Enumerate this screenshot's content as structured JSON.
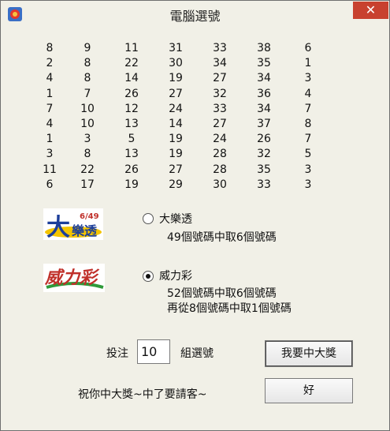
{
  "window": {
    "title": "電腦選號",
    "close_label": "✕"
  },
  "numbers": [
    [
      "8",
      "9",
      "11",
      "31",
      "33",
      "38",
      "6"
    ],
    [
      "2",
      "8",
      "22",
      "30",
      "34",
      "35",
      "1"
    ],
    [
      "4",
      "8",
      "14",
      "19",
      "27",
      "34",
      "3"
    ],
    [
      "1",
      "7",
      "26",
      "27",
      "32",
      "36",
      "4"
    ],
    [
      "7",
      "10",
      "12",
      "24",
      "33",
      "34",
      "7"
    ],
    [
      "4",
      "10",
      "13",
      "14",
      "27",
      "37",
      "8"
    ],
    [
      "1",
      "3",
      "5",
      "19",
      "24",
      "26",
      "7"
    ],
    [
      "3",
      "8",
      "13",
      "19",
      "28",
      "32",
      "5"
    ],
    [
      "11",
      "22",
      "26",
      "27",
      "28",
      "35",
      "3"
    ],
    [
      "6",
      "17",
      "19",
      "29",
      "30",
      "33",
      "3"
    ]
  ],
  "lotto": {
    "logo_text": "大樂透",
    "logo_tag": "6/49",
    "option_label": "大樂透",
    "desc": "49個號碼中取6個號碼",
    "selected": false
  },
  "power": {
    "logo_text": "威力彩",
    "option_label": "威力彩",
    "desc1": "52個號碼中取6個號碼",
    "desc2": "再從8個號碼中取1個號碼",
    "selected": true
  },
  "bet": {
    "prefix": "投注",
    "count": "10",
    "suffix": "組選號"
  },
  "buttons": {
    "generate": "我要中大獎",
    "ok": "好"
  },
  "footer": {
    "message": "祝你中大獎~中了要請客~"
  },
  "colors": {
    "close_bg": "#c8412f",
    "window_bg": "#f1f0e7"
  }
}
